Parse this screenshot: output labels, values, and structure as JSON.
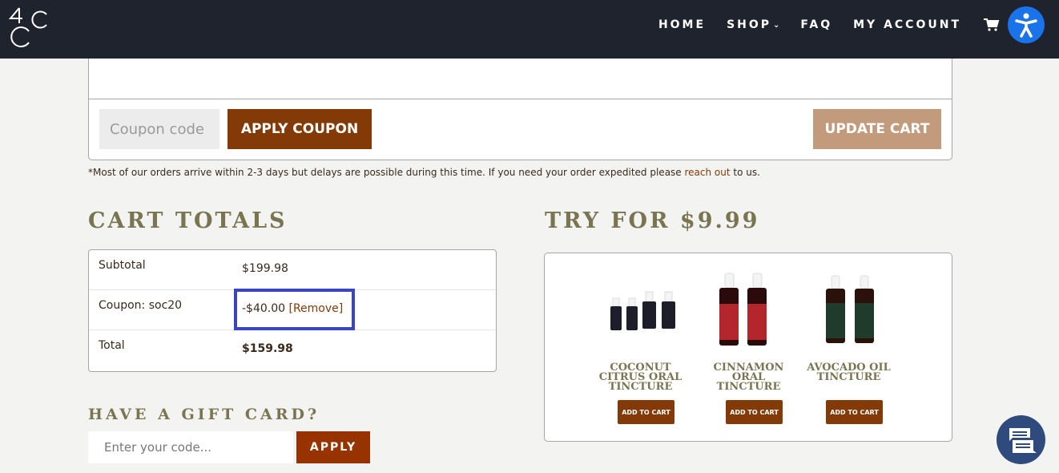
{
  "header": {
    "logo_text": "4CC",
    "nav": [
      {
        "label": "HOME",
        "has_dropdown": false
      },
      {
        "label": "SHOP",
        "has_dropdown": true
      },
      {
        "label": "FAQ",
        "has_dropdown": false
      },
      {
        "label": "MY ACCOUNT",
        "has_dropdown": false
      }
    ],
    "cart_icon": "cart-icon",
    "accessibility_icon": "accessibility-icon"
  },
  "cart_actions": {
    "coupon_placeholder": "Coupon code",
    "coupon_value": "",
    "apply_coupon_label": "APPLY COUPON",
    "update_cart_label": "UPDATE CART"
  },
  "notice": {
    "text": "*Most of our orders arrive within 2-3 days but delays are possible during this time. If you need your order expedited please ",
    "link_text": "reach out",
    "suffix": " to us."
  },
  "cart_totals": {
    "title": "CART TOTALS",
    "rows": [
      {
        "label": "Subtotal",
        "value": "$199.98"
      },
      {
        "label": "Coupon: soc20",
        "value": "-$40.00",
        "action": "[Remove]"
      },
      {
        "label": "Total",
        "value": "$159.98"
      }
    ]
  },
  "gift_card": {
    "title": "HAVE A GIFT CARD?",
    "placeholder": "Enter your code...",
    "apply_label": "APPLY"
  },
  "try_section": {
    "title": "TRY FOR $9.99",
    "products": [
      {
        "name": "COCONUT CITRUS ORAL TINCTURE",
        "button": "ADD TO CART",
        "color": "#1e1e2a"
      },
      {
        "name": "CINNAMON ORAL TINCTURE",
        "button": "ADD TO CART",
        "color": "#b3262b"
      },
      {
        "name": "AVOCADO OIL TINCTURE",
        "button": "ADD TO CART",
        "color": "#1f3b2c"
      }
    ]
  },
  "chat": {
    "icon": "chat-icon"
  },
  "colors": {
    "header_bg": "#1f232d",
    "primary_button": "#843a06",
    "update_button": "#c29a7c",
    "heading": "#7a7551",
    "accessibility": "#1a73e8",
    "highlight": "#3b44c4",
    "chat": "#2f4a7c"
  }
}
